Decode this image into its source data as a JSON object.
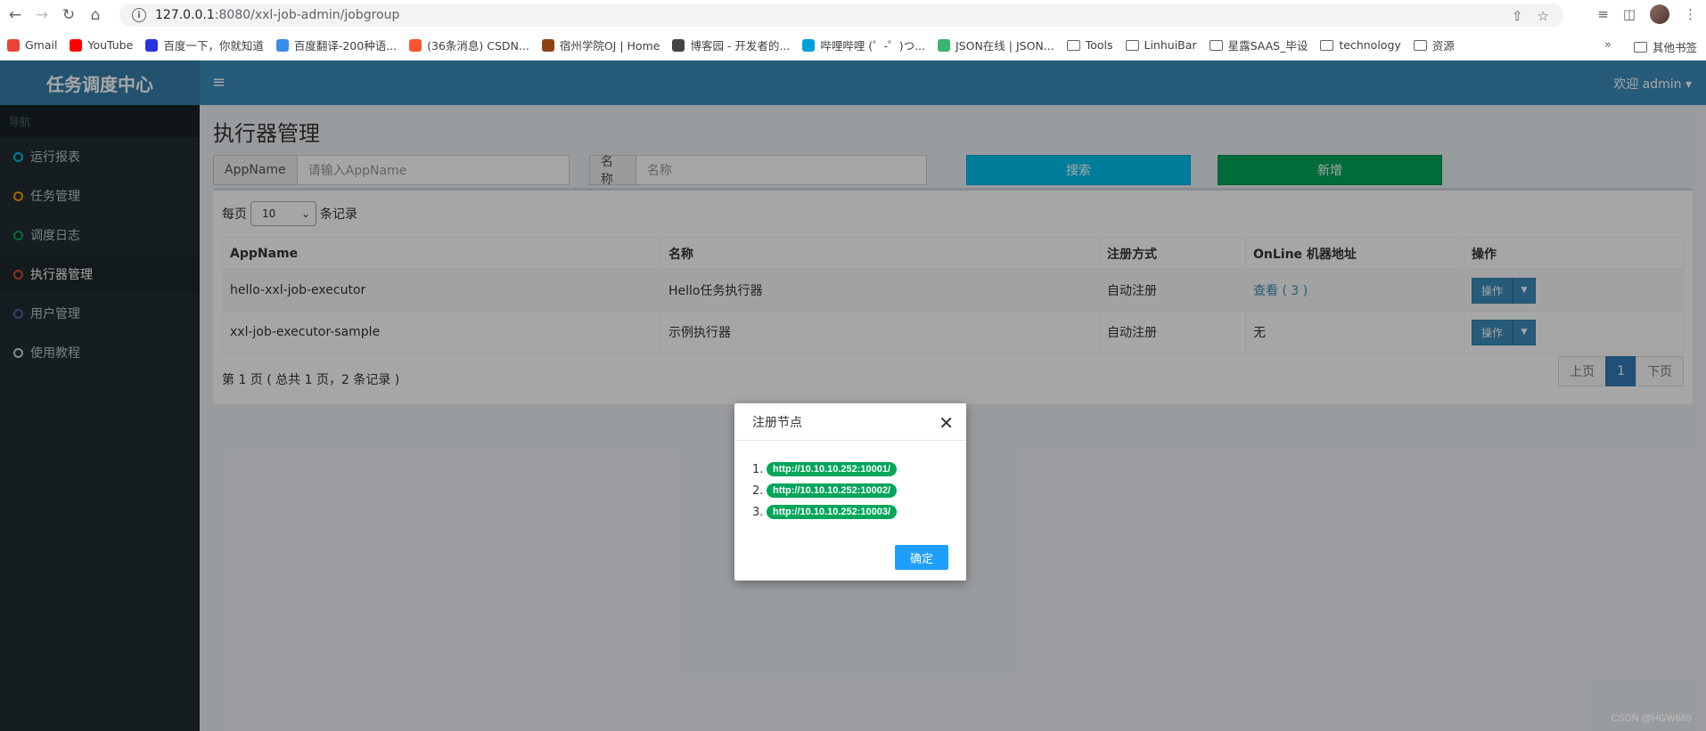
{
  "browser": {
    "url_host": "127.0.0.1",
    "url_path": ":8080/xxl-job-admin/jobgroup",
    "bookmarks": [
      {
        "label": "Gmail",
        "color": "#ea4335"
      },
      {
        "label": "YouTube",
        "color": "#ff0000"
      },
      {
        "label": "百度一下，你就知道",
        "color": "#2932e1"
      },
      {
        "label": "百度翻译-200种语...",
        "color": "#3a8eea"
      },
      {
        "label": "(36条消息) CSDN...",
        "color": "#fc5531"
      },
      {
        "label": "宿州学院OJ | Home",
        "color": "#8b4513"
      },
      {
        "label": "博客园 - 开发者的...",
        "color": "#444444"
      },
      {
        "label": "哔哩哔哩 (゜-゜)つ...",
        "color": "#00a1d6"
      },
      {
        "label": "JSON在线 | JSON...",
        "color": "#3cb371"
      }
    ],
    "folders": [
      "Tools",
      "LinhuiBar",
      "星露SAAS_毕设",
      "technology",
      "资源"
    ],
    "more": "»",
    "other_bookmarks": "其他书签"
  },
  "app": {
    "logo": "任务调度中心",
    "nav_header": "导航",
    "menu": [
      {
        "label": "运行报表",
        "color": "#00c0ef",
        "active": false
      },
      {
        "label": "任务管理",
        "color": "#f39c12",
        "active": false
      },
      {
        "label": "调度日志",
        "color": "#00a65a",
        "active": false
      },
      {
        "label": "执行器管理",
        "color": "#dd4b39",
        "active": true
      },
      {
        "label": "用户管理",
        "color": "#605ca8",
        "active": false
      },
      {
        "label": "使用教程",
        "color": "#d2d6de",
        "active": false
      }
    ],
    "hamburger": "≡",
    "user_menu": "欢迎 admin ▾"
  },
  "page": {
    "title": "执行器管理",
    "search": {
      "appname_label": "AppName",
      "appname_placeholder": "请输入AppName",
      "name_label": "名称",
      "name_placeholder": "名称",
      "search_button": "搜索",
      "add_button": "新增"
    },
    "length": {
      "prefix": "每页",
      "value": "10",
      "suffix": "条记录"
    },
    "table": {
      "headers": [
        "AppName",
        "名称",
        "注册方式",
        "OnLine 机器地址",
        "操作"
      ],
      "rows": [
        {
          "appname": "hello-xxl-job-executor",
          "name": "Hello任务执行器",
          "reg": "自动注册",
          "online": "查看 ( 3 )",
          "op": "操作"
        },
        {
          "appname": "xxl-job-executor-sample",
          "name": "示例执行器",
          "reg": "自动注册",
          "online": "无",
          "op": "操作"
        }
      ]
    },
    "info": "第 1 页 ( 总共 1 页，2 条记录 )",
    "pagination": {
      "prev": "上页",
      "current": "1",
      "next": "下页"
    }
  },
  "modal": {
    "title": "注册节点",
    "close": "✕",
    "nodes": [
      {
        "num": "1.",
        "url": "http://10.10.10.252:10001/"
      },
      {
        "num": "2.",
        "url": "http://10.10.10.252:10002/"
      },
      {
        "num": "3.",
        "url": "http://10.10.10.252:10003/"
      }
    ],
    "ok_button": "确定"
  },
  "watermark": "CSDN @HGW689"
}
